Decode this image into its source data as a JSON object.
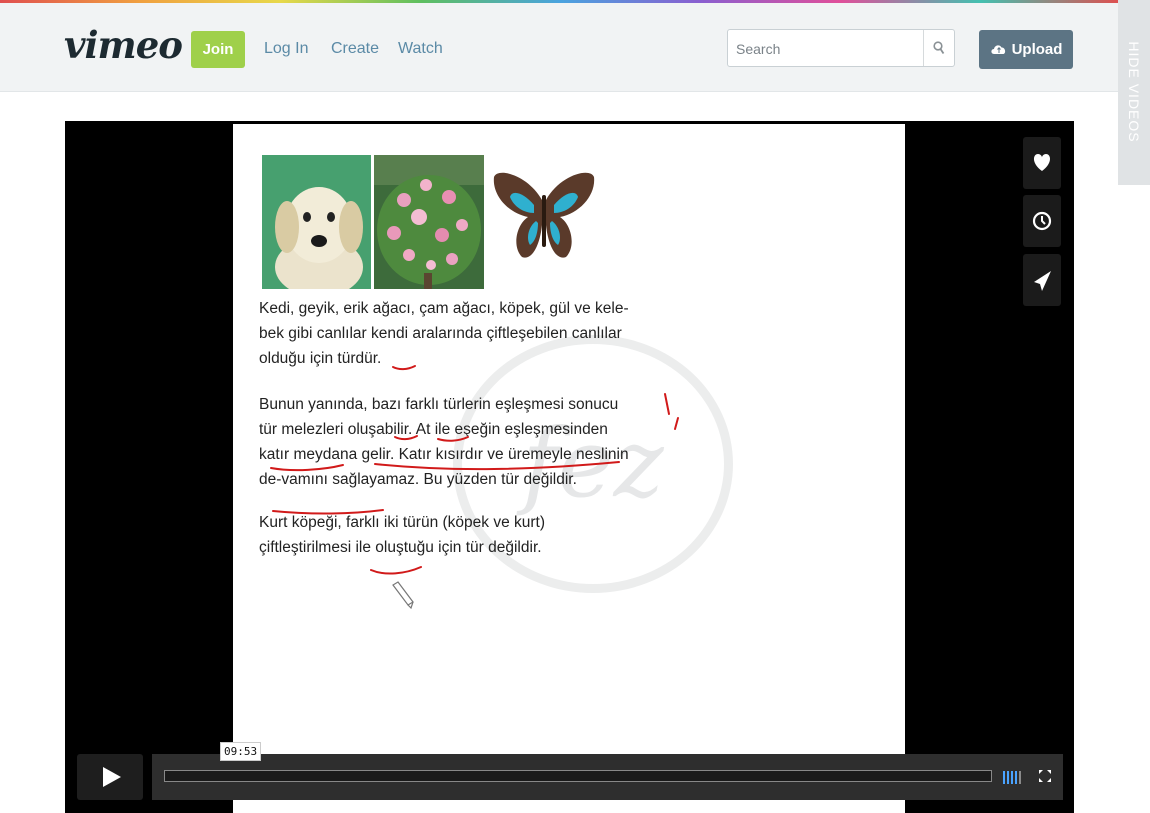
{
  "header": {
    "logo": "vimeo",
    "join_label": "Join",
    "nav": [
      "Log In",
      "Create",
      "Watch"
    ],
    "search_placeholder": "Search",
    "upload_label": "Upload"
  },
  "side_tab": {
    "label": "HIDE VIDEOS"
  },
  "video": {
    "lesson_text": {
      "paragraph1": "Kedi, geyik, erik ağacı, çam ağacı, köpek, gül ve kele-bek gibi canlılar kendi aralarında çiftleşebilen canlılar olduğu için türdür.",
      "paragraph2": "Bunun yanında, bazı farklı türlerin eşleşmesi sonucu tür melezleri oluşabilir. At ile eşeğin eşleşmesinden katır meydana gelir. Katır kısırdır ve üremeyle neslinin de-vamını sağlayamaz. Bu yüzden tür değildir.",
      "paragraph3": "Kurt köpeği, farklı iki türün (köpek ve kurt) çiftleştirilmesi ile oluştuğu için tür değildir."
    },
    "watermark": "fez",
    "timecode": "09:53",
    "progress": 0.0,
    "colors": {
      "accent_join": "#9fd04a",
      "upload": "#5c7484",
      "ink": "#d11a1a",
      "volume": "#4aa3ff"
    }
  }
}
